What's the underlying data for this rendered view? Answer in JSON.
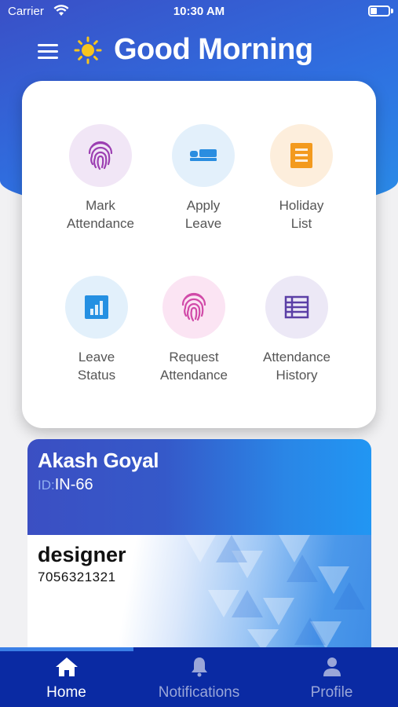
{
  "status_bar": {
    "carrier": "Carrier",
    "time": "10:30 AM"
  },
  "header": {
    "greeting": "Good Morning",
    "sun_icon": "sun-icon",
    "menu_icon": "menu-icon"
  },
  "actions": [
    {
      "line1": "Mark",
      "line2": "Attendance",
      "icon": "fingerprint-icon",
      "bg": "#f1e6f6",
      "color": "#9c3fb2"
    },
    {
      "line1": "Apply",
      "line2": "Leave",
      "icon": "bed-icon",
      "bg": "#e3f0fb",
      "color": "#2a8de0"
    },
    {
      "line1": "Holiday",
      "line2": "List",
      "icon": "list-icon",
      "bg": "#fdeedc",
      "color": "#f39a1e"
    },
    {
      "line1": "Leave",
      "line2": "Status",
      "icon": "bar-chart-icon",
      "bg": "#e2f0fb",
      "color": "#2590e2"
    },
    {
      "line1": "Request",
      "line2": "Attendance",
      "icon": "fingerprint-icon",
      "bg": "#fbe4f3",
      "color": "#d14aa8"
    },
    {
      "line1": "Attendance",
      "line2": "History",
      "icon": "table-icon",
      "bg": "#ece8f6",
      "color": "#5b3fa6"
    }
  ],
  "profile": {
    "name": "Akash Goyal",
    "id_prefix": "ID:",
    "id_value": "IN-66",
    "role": "designer",
    "phone": "7056321321"
  },
  "bottom_nav": {
    "items": [
      {
        "label": "Home",
        "icon": "home-icon",
        "active": true
      },
      {
        "label": "Notifications",
        "icon": "bell-icon",
        "active": false
      },
      {
        "label": "Profile",
        "icon": "person-icon",
        "active": false
      }
    ],
    "active_color": "#ffffff",
    "inactive_color": "#9aa6d8"
  }
}
